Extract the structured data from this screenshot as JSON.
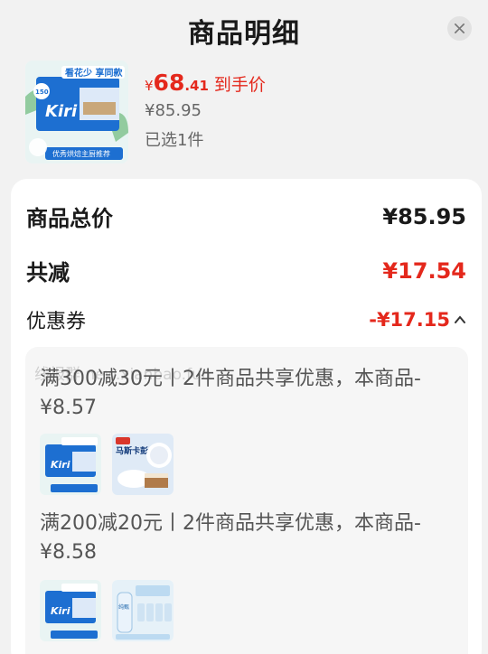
{
  "header": {
    "title": "商品明细"
  },
  "product": {
    "currency": "¥",
    "price_int": "68",
    "price_dec": ".41",
    "price_tag": "到手价",
    "original_price": "¥85.95",
    "selected_count": "已选1件",
    "thumb_text": {
      "brand": "Kiri",
      "banner": "看花少 享同款",
      "footer": "优秀烘焙主厨推荐",
      "badge": "150"
    }
  },
  "summary": {
    "total_label": "商品总价",
    "total_value": "¥85.95",
    "reduce_label": "共减",
    "reduce_value": "¥17.54",
    "coupon_label": "优惠券",
    "coupon_value": "-¥17.15"
  },
  "coupons": {
    "watermark": "线报群 new.xianbao.fun",
    "items": [
      {
        "desc": "满300减30元丨2件商品共享优惠，本商品-¥8.57",
        "second_thumb_title": "马斯卡彭"
      },
      {
        "desc": "满200减20元丨2件商品共享优惠，本商品-¥8.58",
        "second_thumb_title": "纯甄"
      }
    ]
  },
  "colors": {
    "accent_red": "#e4281c",
    "kiri_blue": "#1d6fd1"
  }
}
